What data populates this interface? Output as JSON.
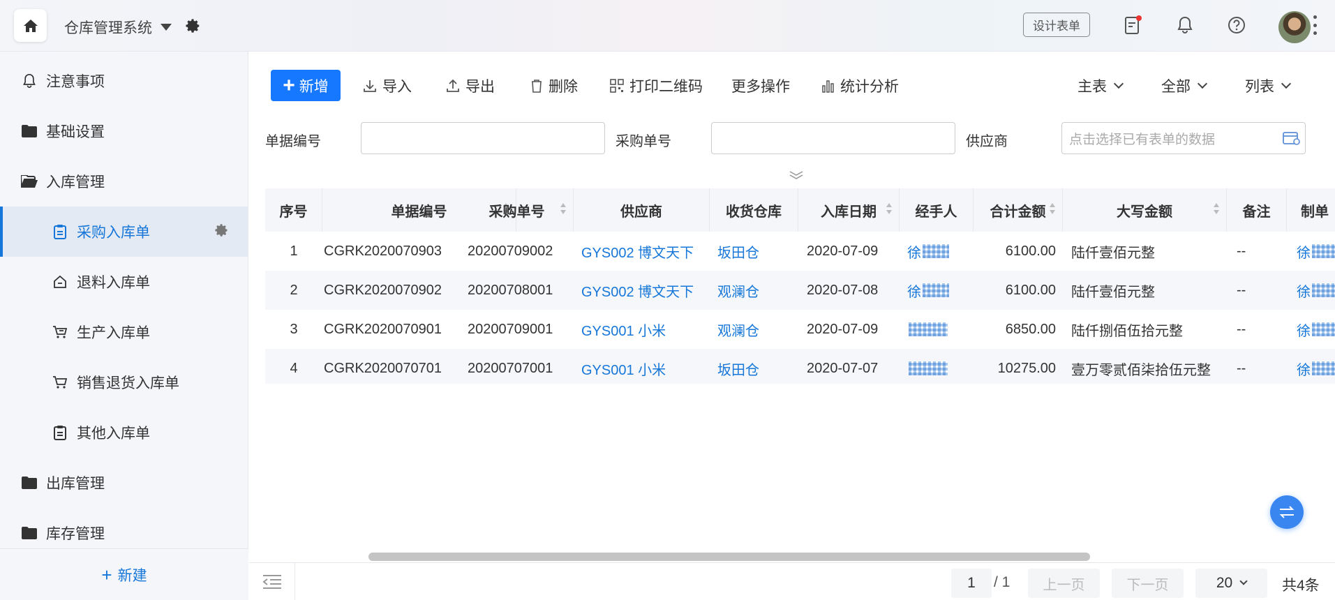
{
  "topbar": {
    "app_title": "仓库管理系统",
    "design_button": "设计表单"
  },
  "sidebar": {
    "items": [
      {
        "label": "注意事项",
        "icon": "bell-icon"
      },
      {
        "label": "基础设置",
        "icon": "folder-icon"
      },
      {
        "label": "入库管理",
        "icon": "folder-open-icon"
      },
      {
        "label": "采购入库单",
        "icon": "clipboard-icon"
      },
      {
        "label": "退料入库单",
        "icon": "home-return-icon"
      },
      {
        "label": "生产入库单",
        "icon": "cart-icon"
      },
      {
        "label": "销售退货入库单",
        "icon": "cart-icon"
      },
      {
        "label": "其他入库单",
        "icon": "clipboard-icon"
      },
      {
        "label": "出库管理",
        "icon": "folder-icon"
      },
      {
        "label": "库存管理",
        "icon": "folder-icon"
      }
    ],
    "new_label": "新建"
  },
  "toolbar": {
    "add": "新增",
    "import": "导入",
    "export": "导出",
    "delete": "删除",
    "print_qr": "打印二维码",
    "more": "更多操作",
    "stats": "统计分析",
    "main_table": "主表",
    "all": "全部",
    "list": "列表"
  },
  "filters": {
    "doc_no_label": "单据编号",
    "po_no_label": "采购单号",
    "supplier_label": "供应商",
    "supplier_placeholder": "点击选择已有表单的数据"
  },
  "table": {
    "headers": [
      "序号",
      "单据编号",
      "采购单号",
      "供应商",
      "收货仓库",
      "入库日期",
      "经手人",
      "合计金额",
      "大写金额",
      "备注",
      "制单"
    ],
    "rows": [
      {
        "no": "1",
        "doc": "CGRK2020070903",
        "po": "20200709002",
        "supplier": "GYS002 博文天下",
        "warehouse": "坂田仓",
        "date": "2020-07-09",
        "handler": "徐",
        "amount": "6100.00",
        "upper": "陆仟壹佰元整",
        "note": "--",
        "maker": "徐"
      },
      {
        "no": "2",
        "doc": "CGRK2020070902",
        "po": "20200708001",
        "supplier": "GYS002 博文天下",
        "warehouse": "观澜仓",
        "date": "2020-07-08",
        "handler": "徐",
        "amount": "6100.00",
        "upper": "陆仟壹佰元整",
        "note": "--",
        "maker": "徐"
      },
      {
        "no": "3",
        "doc": "CGRK2020070901",
        "po": "20200709001",
        "supplier": "GYS001 小米",
        "warehouse": "观澜仓",
        "date": "2020-07-09",
        "handler": "",
        "amount": "6850.00",
        "upper": "陆仟捌佰伍拾元整",
        "note": "--",
        "maker": "徐"
      },
      {
        "no": "4",
        "doc": "CGRK2020070701",
        "po": "20200707001",
        "supplier": "GYS001 小米",
        "warehouse": "坂田仓",
        "date": "2020-07-07",
        "handler": "",
        "amount": "10275.00",
        "upper": "壹万零贰佰柒拾伍元整",
        "note": "--",
        "maker": "徐"
      }
    ]
  },
  "pagination": {
    "current": "1",
    "total_pages": "/ 1",
    "prev": "上一页",
    "next": "下一页",
    "page_size": "20",
    "total_count": "共4条"
  },
  "colors": {
    "accent": "#1677ff",
    "link": "#1677d9",
    "sidebar_bg": "#f4f6fa"
  }
}
